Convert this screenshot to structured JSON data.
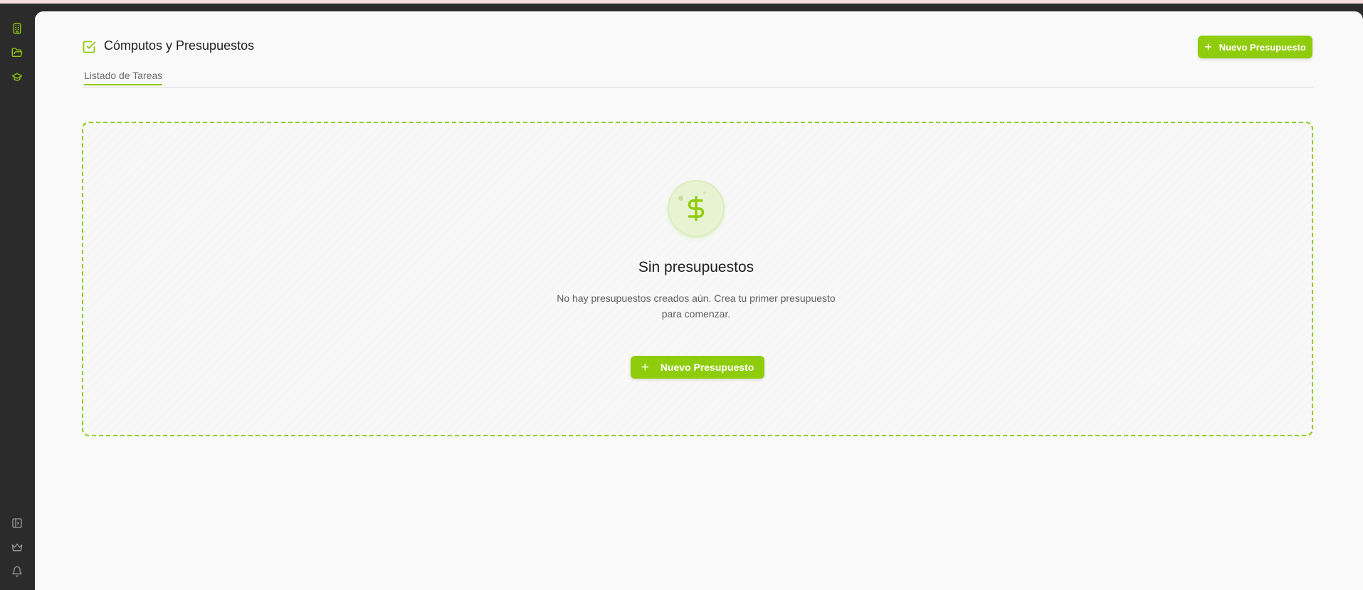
{
  "header": {
    "title": "Cómputos y Presupuestos",
    "new_button_label": "Nuevo Presupuesto",
    "new_button_icon": "plus-icon"
  },
  "tabs": [
    {
      "label": "Listado de Tareas",
      "active": true
    }
  ],
  "empty_state": {
    "icon": "dollar-icon",
    "title": "Sin presupuestos",
    "description": "No hay presupuestos creados aún. Crea tu primer presupuesto para comenzar.",
    "button_label": "Nuevo Presupuesto",
    "button_icon": "plus-icon"
  },
  "sidebar": {
    "top_icons": [
      "building-icon",
      "folder-open-icon",
      "graduation-cap-icon"
    ],
    "bottom_icons": [
      "sidebar-toggle-icon",
      "crown-icon",
      "bell-icon"
    ]
  },
  "colors": {
    "accent": "#8fcc0b",
    "sidebar_bg": "#2b2b2b",
    "main_bg": "#f9f9f9",
    "sidebar_icon": "#9a9a9a"
  },
  "glyphs": {
    "plus": "+"
  }
}
